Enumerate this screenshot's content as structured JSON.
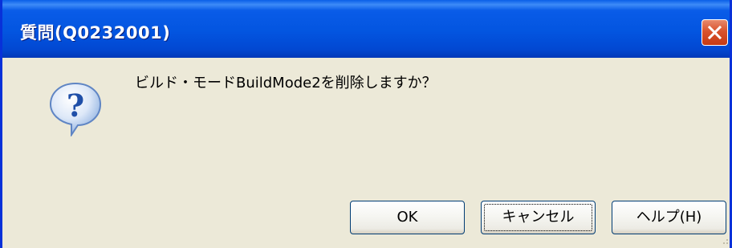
{
  "window": {
    "title": "質問(Q0232001)",
    "close_icon": "close-icon"
  },
  "message": {
    "text": "ビルド・モードBuildMode2を削除しますか？",
    "icon": "question-icon"
  },
  "buttons": {
    "ok_label": "OK",
    "cancel_label": "キャンセル",
    "help_label": "ヘルプ(H)"
  },
  "colors": {
    "titlebar": "#0355e0",
    "frame": "#0831d9",
    "client_bg": "#ece9d8",
    "close_button": "#d9532c",
    "question_icon": "#2a5db0"
  }
}
